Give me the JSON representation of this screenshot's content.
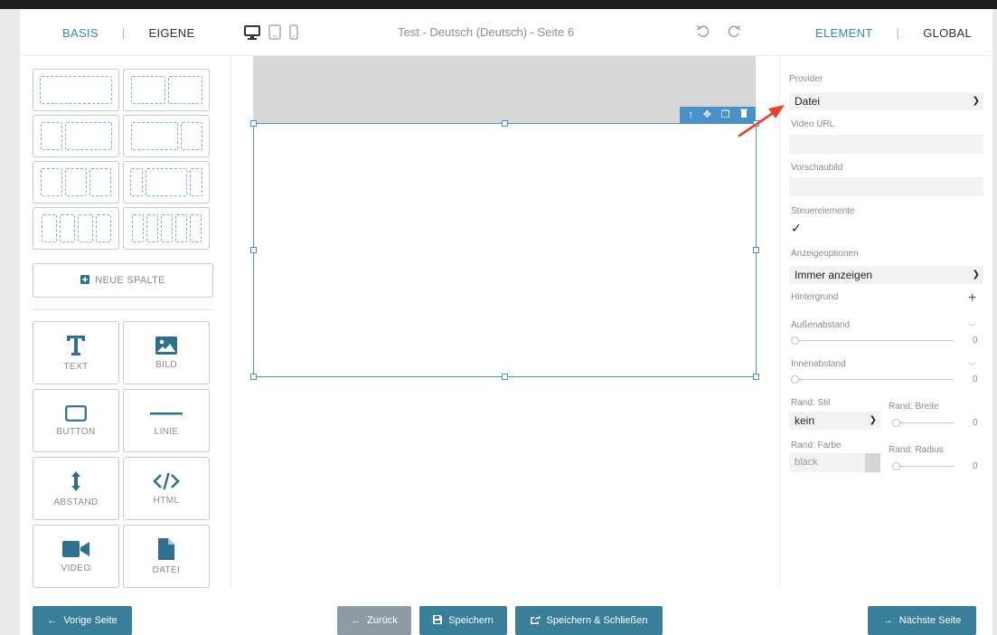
{
  "header": {
    "left_tabs": [
      "BASIS",
      "EIGENE"
    ],
    "right_tabs": [
      "ELEMENT",
      "GLOBAL"
    ],
    "separator": "|",
    "title": "Test - Deutsch (Deutsch) - Seite 6",
    "devices": [
      "desktop-icon",
      "tablet-icon",
      "mobile-icon"
    ],
    "history": [
      "undo-icon",
      "redo-icon"
    ]
  },
  "left_panel": {
    "new_column_label": "NEUE SPALTE",
    "elements": [
      "TEXT",
      "BILD",
      "BUTTON",
      "LINIE",
      "ABSTAND",
      "HTML",
      "VIDEO",
      "DATEI"
    ]
  },
  "canvas": {
    "toolbar_icons": [
      "arrow-up-icon",
      "move-icon",
      "copy-icon",
      "delete-icon"
    ]
  },
  "right_panel": {
    "provider_label": "Provider",
    "provider_value": "Datei",
    "video_url_label": "Video URL",
    "preview_label": "Vorschaubild",
    "controls_label": "Steuerelemente",
    "controls_check": "✓",
    "display_label": "Anzeigeoptionen",
    "display_value": "Immer anzeigen",
    "background_label": "Hintergrund",
    "background_add": "+",
    "margin_label": "Außenabstand",
    "margin_value": "0",
    "padding_label": "Innenabstand",
    "padding_value": "0",
    "border_style_label": "Rand: Stil",
    "border_style_value": "kein",
    "border_width_label": "Rand: Breite",
    "border_width_value": "0",
    "border_color_label": "Rand: Farbe",
    "border_color_value": "black",
    "border_radius_label": "Rand: Radius",
    "border_radius_value": "0"
  },
  "footer": {
    "prev_page": "Vorige Seite",
    "back": "Zurück",
    "save": "Speichern",
    "save_close": "Speichern & Schließen",
    "next_page": "Nächste Seite"
  },
  "colors": {
    "accent": "#3a86b8",
    "button": "#3a7f9a",
    "button_muted": "#8e9ba4",
    "selection": "#4a90c9",
    "annotation_arrow": "#e8412c"
  }
}
